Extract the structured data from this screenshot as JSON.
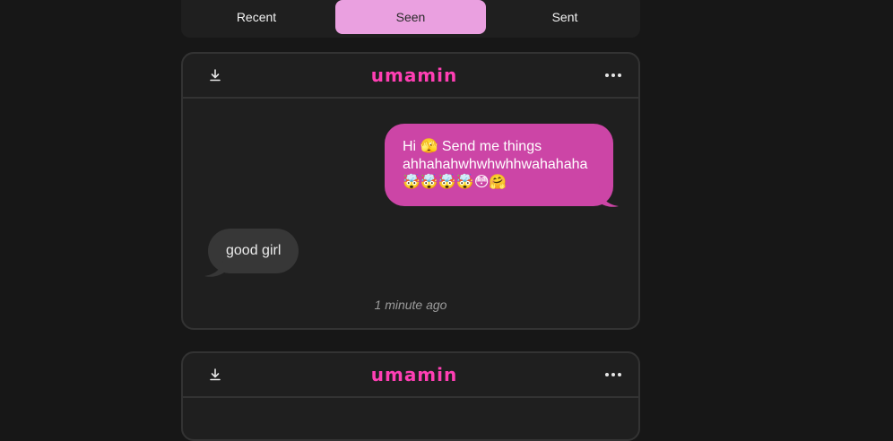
{
  "tabs": [
    {
      "label": "Recent",
      "active": false
    },
    {
      "label": "Seen",
      "active": true
    },
    {
      "label": "Sent",
      "active": false
    }
  ],
  "cards": [
    {
      "brand": "umamin",
      "message_out": "Hi 🫣 Send me things ahhahahwhwhwhhwahahaha 🤯🤯🤯🤯😳🤗",
      "message_in": "good girl",
      "timestamp": "1 minute ago"
    },
    {
      "brand": "umamin"
    }
  ],
  "icons": {
    "download": "download-icon",
    "more": "more-horizontal-icon"
  },
  "colors": {
    "accent": "#ff3fb4",
    "tab_active": "#eaa0e0",
    "bubble_out": "#cc45a6",
    "bubble_in": "#373737"
  }
}
